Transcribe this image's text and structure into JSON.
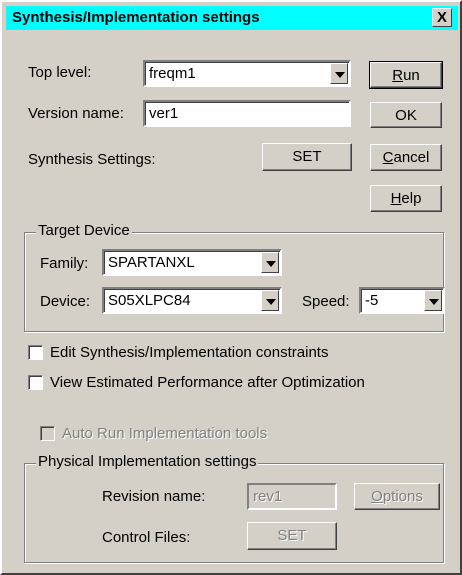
{
  "window": {
    "title": "Synthesis/Implementation settings",
    "close_glyph": "X"
  },
  "top_level": {
    "label": "Top level:",
    "value": "freqm1"
  },
  "version_name": {
    "label": "Version name:",
    "value": "ver1"
  },
  "synthesis_settings": {
    "label": "Synthesis Settings:",
    "button": "SET"
  },
  "buttons": {
    "run_prefix": "",
    "run_mnemonic": "R",
    "run_rest": "un",
    "ok": "OK",
    "cancel_mnemonic": "C",
    "cancel_rest": "ancel",
    "help_mnemonic": "H",
    "help_rest": "elp"
  },
  "target_device": {
    "title": "Target Device",
    "family_label": "Family:",
    "family_value": "SPARTANXL",
    "device_label": "Device:",
    "device_value": "S05XLPC84",
    "speed_label": "Speed:",
    "speed_value": "-5"
  },
  "options": {
    "edit_constraints": "Edit Synthesis/Implementation constraints",
    "edit_constraints_checked": false,
    "view_performance": "View Estimated Performance after Optimization",
    "view_performance_checked": false,
    "auto_run": "Auto Run Implementation tools",
    "auto_run_checked": false
  },
  "physical": {
    "title": "Physical Implementation settings",
    "revision_label": "Revision name:",
    "revision_value": "rev1",
    "options_mnemonic": "O",
    "options_rest": "ptions",
    "control_files_label": "Control Files:",
    "control_files_button": "SET"
  }
}
